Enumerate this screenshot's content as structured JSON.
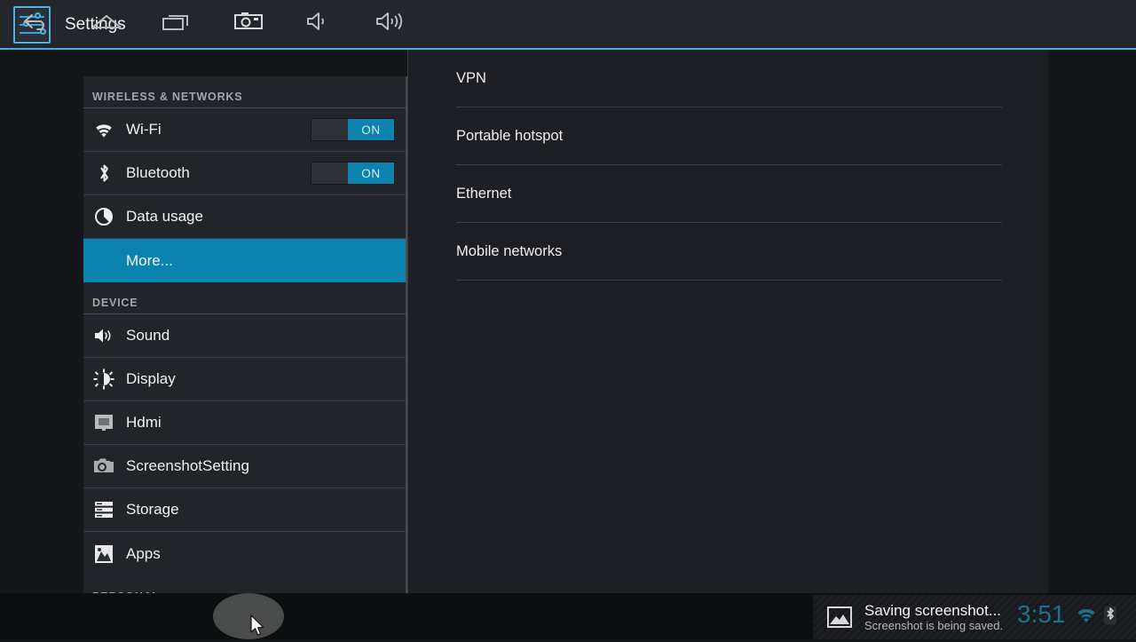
{
  "header": {
    "title": "Settings",
    "app_icon": "settings-sliders-icon",
    "accent_rule_color": "#33b5e5"
  },
  "colors": {
    "accent": "#0c82ae",
    "accent_bright": "#33b5e5",
    "sidebar_bg": "#212429",
    "panel_bg": "#1e1f24",
    "header_bg": "#23262c",
    "navbar_bg": "#0d0e10",
    "clock": "#1f6f8e"
  },
  "sidebar": {
    "sections": [
      {
        "title": "WIRELESS & NETWORKS",
        "items": [
          {
            "label": "Wi-Fi",
            "icon": "wifi-icon",
            "toggle": "ON",
            "selected": false
          },
          {
            "label": "Bluetooth",
            "icon": "bluetooth-icon",
            "toggle": "ON",
            "selected": false
          },
          {
            "label": "Data usage",
            "icon": "data-usage-icon",
            "toggle": null,
            "selected": false
          },
          {
            "label": "More...",
            "icon": null,
            "toggle": null,
            "selected": true
          }
        ]
      },
      {
        "title": "DEVICE",
        "items": [
          {
            "label": "Sound",
            "icon": "sound-icon",
            "toggle": null,
            "selected": false
          },
          {
            "label": "Display",
            "icon": "display-brightness-icon",
            "toggle": null,
            "selected": false
          },
          {
            "label": "Hdmi",
            "icon": "hdmi-monitor-icon",
            "toggle": null,
            "selected": false
          },
          {
            "label": "ScreenshotSetting",
            "icon": "camera-icon",
            "toggle": null,
            "selected": false
          },
          {
            "label": "Storage",
            "icon": "storage-icon",
            "toggle": null,
            "selected": false
          },
          {
            "label": "Apps",
            "icon": "apps-image-icon",
            "toggle": null,
            "selected": false
          }
        ]
      },
      {
        "title": "PERSONAL",
        "items": []
      }
    ]
  },
  "panel": {
    "items": [
      {
        "label": "VPN"
      },
      {
        "label": "Portable hotspot"
      },
      {
        "label": "Ethernet"
      },
      {
        "label": "Mobile networks"
      }
    ]
  },
  "navbar": {
    "buttons": [
      {
        "name": "back-icon",
        "label": "Back"
      },
      {
        "name": "home-icon",
        "label": "Home"
      },
      {
        "name": "recents-icon",
        "label": "Recent apps"
      },
      {
        "name": "screenshot-icon",
        "label": "Screenshot"
      },
      {
        "name": "volume-down-icon",
        "label": "Volume down"
      },
      {
        "name": "volume-up-icon",
        "label": "Volume up"
      }
    ],
    "active_button": "screenshot-icon"
  },
  "status": {
    "notification": {
      "icon": "image-icon",
      "title": "Saving screenshot...",
      "subtitle": "Screenshot is being saved."
    },
    "clock": "3:51",
    "wifi": "wifi-status-icon",
    "bluetooth": "bluetooth-status-icon"
  }
}
